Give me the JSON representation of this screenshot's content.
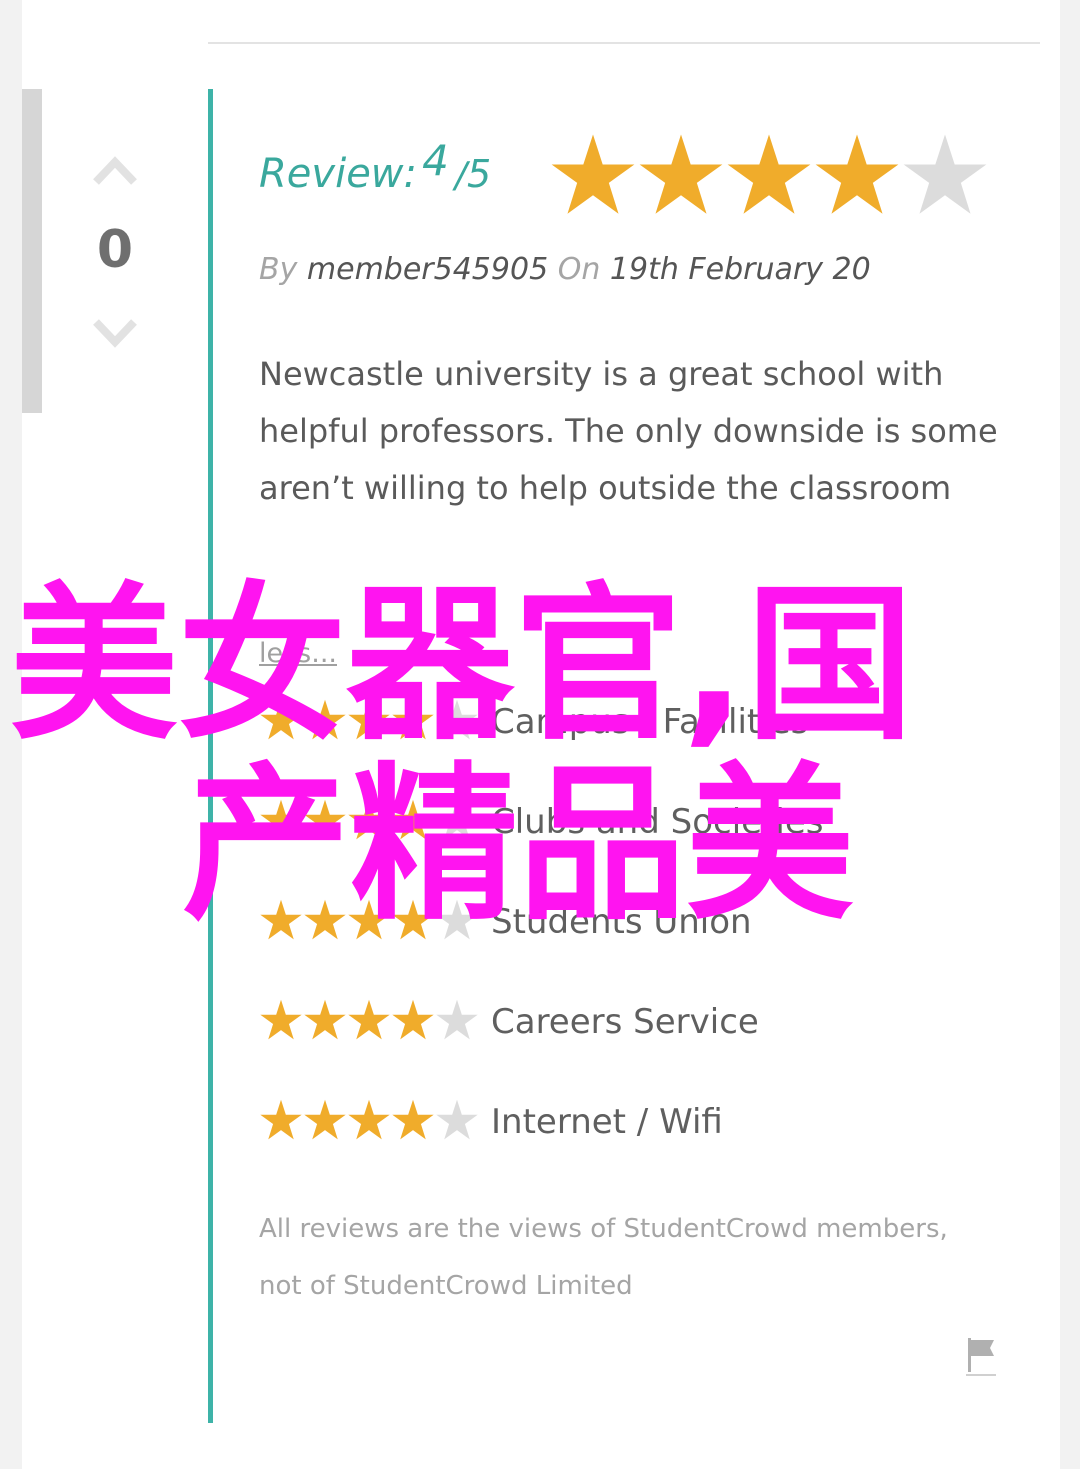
{
  "vote": {
    "count": "0"
  },
  "review": {
    "label": "Review:",
    "score": "4",
    "slash": "/",
    "max": "5",
    "rating": 4,
    "by_label": "By",
    "author": "member545905",
    "on_label": "On",
    "date": "19th February 20",
    "body": "Newcastle university is a great school with helpful professors. The only downside is some aren’t willing to help outside the classroom",
    "less_link": "less..."
  },
  "category_ratings": [
    {
      "label": "Campus / Facilities",
      "rating": 4
    },
    {
      "label": "Clubs and Societies",
      "rating": 4
    },
    {
      "label": "Students Union",
      "rating": 4
    },
    {
      "label": "Careers Service",
      "rating": 4
    },
    {
      "label": "Internet / Wifi",
      "rating": 4
    }
  ],
  "disclaimer": "All reviews are the views of StudentCrowd members, not of StudentCrowd Limited",
  "overlay": {
    "line1": "美女器官,国",
    "line2": "产精品美"
  },
  "colors": {
    "accent": "#3eb3a8",
    "star_on": "#f0ac2b",
    "star_off": "#dcdcdc",
    "overlay": "#ff14f0"
  },
  "icons": {
    "vote_up": "chevron-up-icon",
    "vote_down": "chevron-down-icon",
    "flag": "flag-icon",
    "star": "star-icon"
  }
}
